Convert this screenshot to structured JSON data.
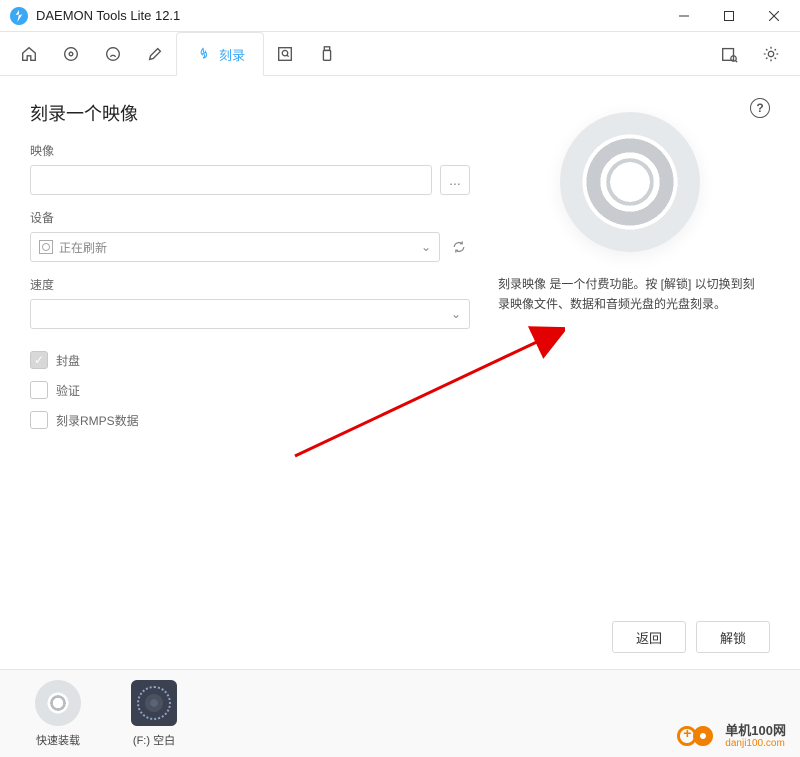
{
  "window": {
    "title": "DAEMON Tools Lite 12.1"
  },
  "toolbar": {
    "burn_tab_label": "刻录"
  },
  "page": {
    "title": "刻录一个映像",
    "labels": {
      "image": "映像",
      "device": "设备",
      "speed": "速度"
    },
    "device_value": "正在刷新",
    "browse_ellipsis": "...",
    "checkboxes": {
      "finalize": {
        "label": "封盘",
        "checked": true
      },
      "verify": {
        "label": "验证",
        "checked": false
      },
      "rmps": {
        "label": "刻录RMPS数据",
        "checked": false
      }
    },
    "help_glyph": "?"
  },
  "promo": {
    "text": "刻录映像 是一个付费功能。按 [解锁] 以切换到刻录映像文件、数据和音频光盘的光盘刻录。"
  },
  "buttons": {
    "back": "返回",
    "unlock": "解锁"
  },
  "dock": {
    "quick_mount": "快速装载",
    "drive_f_blank": "(F:) 空白"
  },
  "brand": {
    "name": "单机100网",
    "domain": "danji100.com"
  }
}
